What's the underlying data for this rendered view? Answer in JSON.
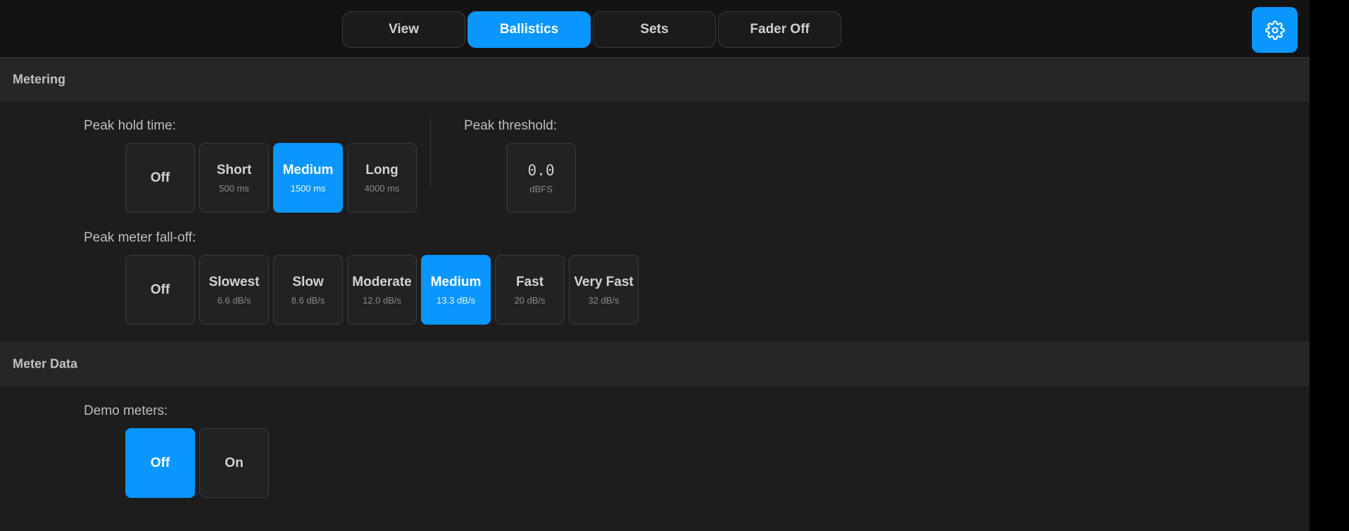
{
  "tabs": [
    {
      "label": "View",
      "active": false
    },
    {
      "label": "Ballistics",
      "active": true
    },
    {
      "label": "Sets",
      "active": false
    },
    {
      "label": "Fader Off",
      "active": false
    }
  ],
  "settings_icon": "gear-icon",
  "accent_color": "#0a96ff",
  "metering": {
    "title": "Metering",
    "peak_hold": {
      "label": "Peak hold time:",
      "options": [
        {
          "label": "Off",
          "sub": "",
          "active": false
        },
        {
          "label": "Short",
          "sub": "500 ms",
          "active": false
        },
        {
          "label": "Medium",
          "sub": "1500 ms",
          "active": true
        },
        {
          "label": "Long",
          "sub": "4000 ms",
          "active": false
        }
      ]
    },
    "peak_threshold": {
      "label": "Peak threshold:",
      "value": "0.0",
      "unit": "dBFS"
    },
    "falloff": {
      "label": "Peak meter fall-off:",
      "options": [
        {
          "label": "Off",
          "sub": "",
          "active": false
        },
        {
          "label": "Slowest",
          "sub": "6.6 dB/s",
          "active": false
        },
        {
          "label": "Slow",
          "sub": "8.6 dB/s",
          "active": false
        },
        {
          "label": "Moderate",
          "sub": "12.0 dB/s",
          "active": false
        },
        {
          "label": "Medium",
          "sub": "13.3 dB/s",
          "active": true
        },
        {
          "label": "Fast",
          "sub": "20 dB/s",
          "active": false
        },
        {
          "label": "Very Fast",
          "sub": "32 dB/s",
          "active": false
        }
      ]
    }
  },
  "meter_data": {
    "title": "Meter Data",
    "demo": {
      "label": "Demo meters:",
      "options": [
        {
          "label": "Off",
          "active": true
        },
        {
          "label": "On",
          "active": false
        }
      ]
    }
  }
}
